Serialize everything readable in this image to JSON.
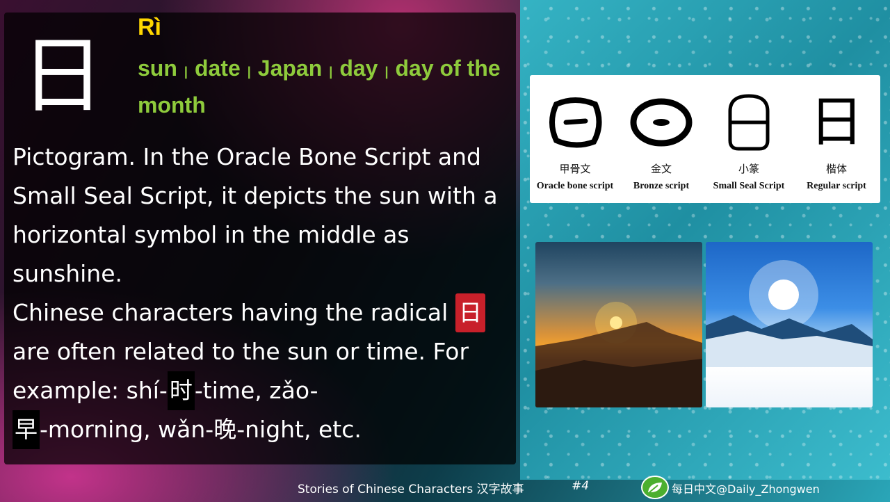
{
  "character": {
    "hanzi": "日",
    "pinyin": "Rì",
    "meanings": [
      "sun",
      "date",
      "Japan",
      "day",
      "day of the month"
    ],
    "separator": "|"
  },
  "description": {
    "line1": "Pictogram. In the Oracle Bone Script and Small Seal Script, it depicts the sun with a horizontal symbol in the middle as sunshine.",
    "line2_start": "Chinese characters having the radical",
    "radical": "日",
    "line2_rest": "are often related to the sun or time. For example: shí-",
    "ex1_hanzi": "时",
    "ex1_rest": "-time, zǎo-",
    "ex2_hanzi": "早",
    "ex2_rest": "-morning, wǎn-",
    "ex3_hanzi": "晚",
    "ex3_rest": "-night, etc."
  },
  "scripts": [
    {
      "cn": "甲骨文",
      "en": "Oracle bone script"
    },
    {
      "cn": "金文",
      "en": "Bronze script"
    },
    {
      "cn": "小篆",
      "en": "Small Seal Script"
    },
    {
      "cn": "楷体",
      "en": "Regular script",
      "glyph": "日"
    }
  ],
  "photos": {
    "sunset": "sunset-mountain-photo",
    "snow": "sun-snow-mountain-photo"
  },
  "footer": {
    "series": "Stories of Chinese Characters 汉字故事",
    "number": "#4",
    "handle": "每日中文@Daily_Zhongwen",
    "logo_icon": "leaf-logo-icon"
  },
  "colors": {
    "pinyin": "#ffd700",
    "meanings": "#8ecb3c",
    "radical_bg": "#c8202a"
  }
}
